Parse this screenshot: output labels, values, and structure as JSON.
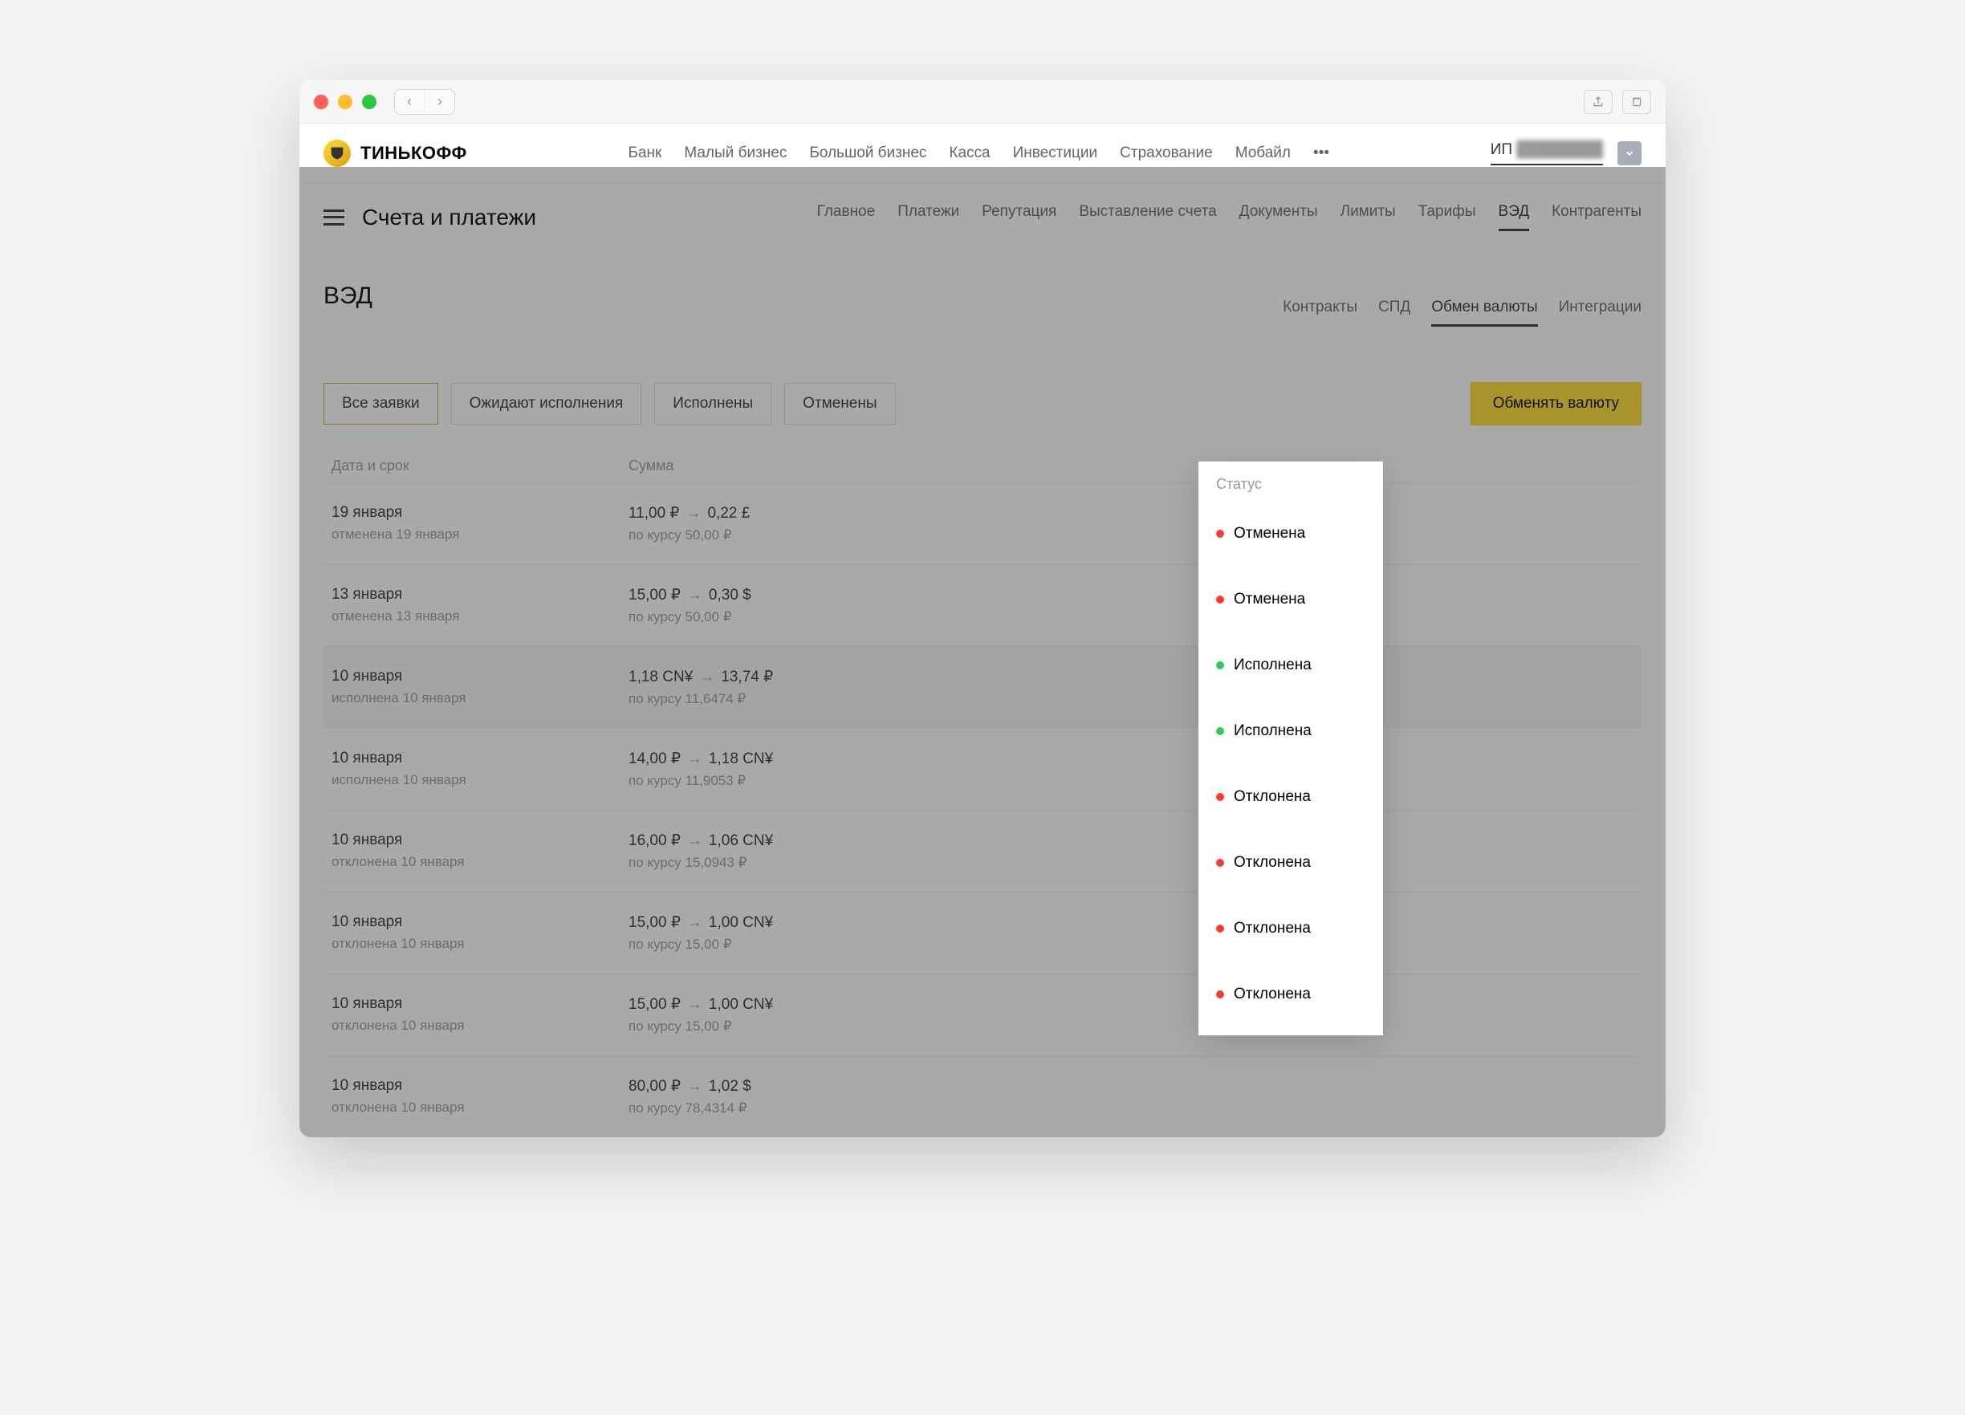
{
  "brand": "ТИНЬКОФФ",
  "topnav": [
    "Банк",
    "Малый бизнес",
    "Большой бизнес",
    "Касса",
    "Инвестиции",
    "Страхование",
    "Мобайл"
  ],
  "user": {
    "prefix": "ИП",
    "name": "████████"
  },
  "subhead": {
    "title": "Счета и платежи"
  },
  "subnav": [
    "Главное",
    "Платежи",
    "Репутация",
    "Выставление счета",
    "Документы",
    "Лимиты",
    "Тарифы",
    "ВЭД",
    "Контрагенты"
  ],
  "subnav_active": "ВЭД",
  "page_title": "ВЭД",
  "tabs3": [
    "Контракты",
    "СПД",
    "Обмен валюты",
    "Интеграции"
  ],
  "tabs3_active": "Обмен валюты",
  "filters": [
    "Все заявки",
    "Ожидают исполнения",
    "Исполнены",
    "Отменены"
  ],
  "filters_active": "Все заявки",
  "cta": "Обменять валюту",
  "columns": {
    "c1": "Дата и срок",
    "c2": "Сумма",
    "c3": "Статус"
  },
  "rows": [
    {
      "date": "19 января",
      "sub": "отменена 19 января",
      "from": "11,00 ₽",
      "to": "0,22 £",
      "rate": "по курсу 50,00 ₽",
      "status": "Отменена",
      "color": "red",
      "hl": false
    },
    {
      "date": "13 января",
      "sub": "отменена 13 января",
      "from": "15,00 ₽",
      "to": "0,30 $",
      "rate": "по курсу 50,00 ₽",
      "status": "Отменена",
      "color": "red",
      "hl": false
    },
    {
      "date": "10 января",
      "sub": "исполнена 10 января",
      "from": "1,18 CN¥",
      "to": "13,74 ₽",
      "rate": "по курсу 11,6474 ₽",
      "status": "Исполнена",
      "color": "green",
      "hl": true
    },
    {
      "date": "10 января",
      "sub": "исполнена 10 января",
      "from": "14,00 ₽",
      "to": "1,18 CN¥",
      "rate": "по курсу 11,9053 ₽",
      "status": "Исполнена",
      "color": "green",
      "hl": false
    },
    {
      "date": "10 января",
      "sub": "отклонена 10 января",
      "from": "16,00 ₽",
      "to": "1,06 CN¥",
      "rate": "по курсу 15,0943 ₽",
      "status": "Отклонена",
      "color": "red",
      "hl": false
    },
    {
      "date": "10 января",
      "sub": "отклонена 10 января",
      "from": "15,00 ₽",
      "to": "1,00 CN¥",
      "rate": "по курсу 15,00 ₽",
      "status": "Отклонена",
      "color": "red",
      "hl": false
    },
    {
      "date": "10 января",
      "sub": "отклонена 10 января",
      "from": "15,00 ₽",
      "to": "1,00 CN¥",
      "rate": "по курсу 15,00 ₽",
      "status": "Отклонена",
      "color": "red",
      "hl": false
    },
    {
      "date": "10 января",
      "sub": "отклонена 10 января",
      "from": "80,00 ₽",
      "to": "1,02 $",
      "rate": "по курсу 78,4314 ₽",
      "status": "Отклонена",
      "color": "red",
      "hl": false
    }
  ],
  "popup_header": "Статус"
}
